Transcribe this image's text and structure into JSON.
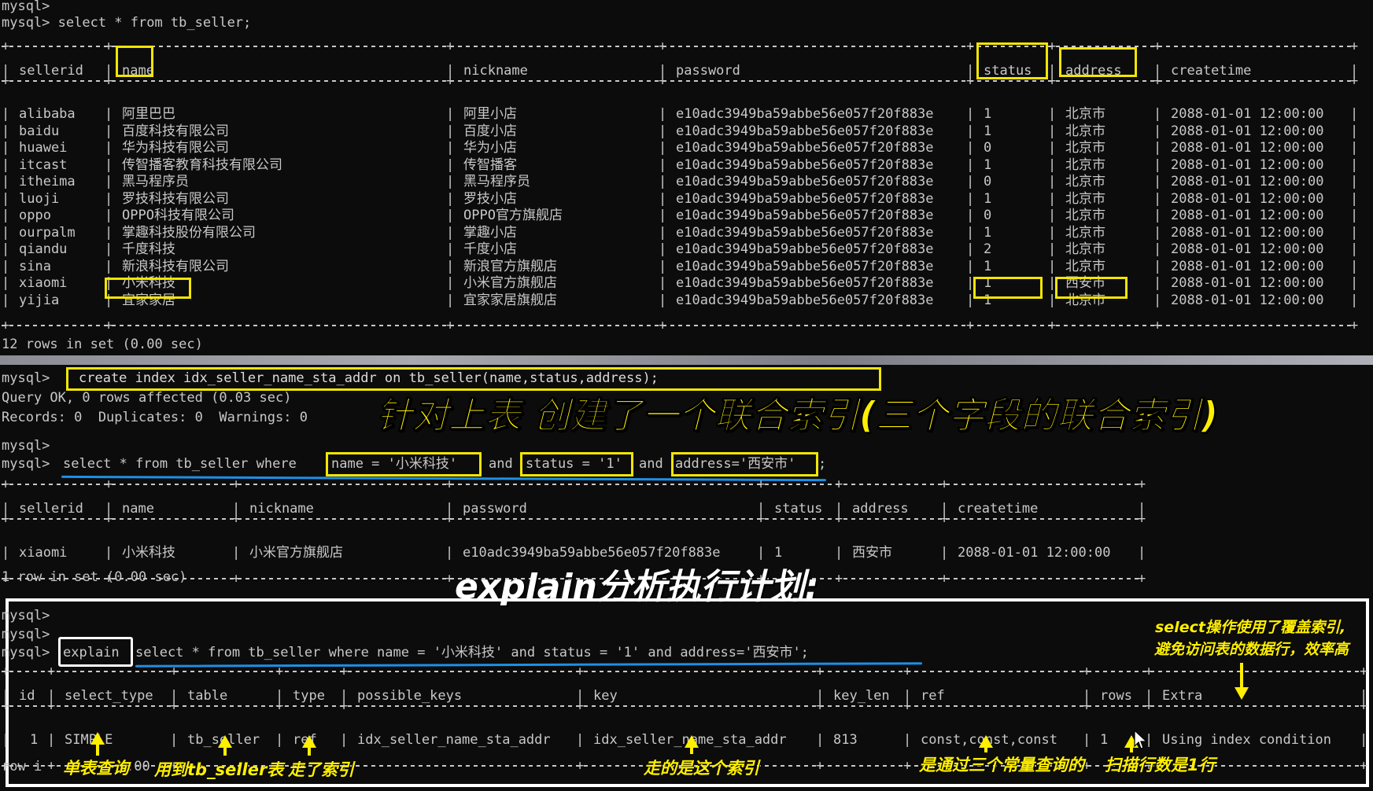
{
  "terminal": {
    "prompt_empty": "mysql>",
    "query1": "mysql> select * from tb_seller;",
    "sep1": "+----------+--------------------------------------+--------------------------+-----------------------------------+--------+----------+---------------------+",
    "header1": [
      "sellerid",
      "name",
      "nickname",
      "password",
      "status",
      "address",
      "createtime"
    ],
    "rows1": [
      [
        "alibaba",
        "阿里巴巴",
        "阿里小店",
        "e10adc3949ba59abbe56e057f20f883e",
        "1",
        "北京市",
        "2088-01-01 12:00:00"
      ],
      [
        "baidu",
        "百度科技有限公司",
        "百度小店",
        "e10adc3949ba59abbe56e057f20f883e",
        "1",
        "北京市",
        "2088-01-01 12:00:00"
      ],
      [
        "huawei",
        "华为科技有限公司",
        "华为小店",
        "e10adc3949ba59abbe56e057f20f883e",
        "0",
        "北京市",
        "2088-01-01 12:00:00"
      ],
      [
        "itcast",
        "传智播客教育科技有限公司",
        "传智播客",
        "e10adc3949ba59abbe56e057f20f883e",
        "1",
        "北京市",
        "2088-01-01 12:00:00"
      ],
      [
        "itheima",
        "黑马程序员",
        "黑马程序员",
        "e10adc3949ba59abbe56e057f20f883e",
        "0",
        "北京市",
        "2088-01-01 12:00:00"
      ],
      [
        "luoji",
        "罗技科技有限公司",
        "罗技小店",
        "e10adc3949ba59abbe56e057f20f883e",
        "1",
        "北京市",
        "2088-01-01 12:00:00"
      ],
      [
        "oppo",
        "OPPO科技有限公司",
        "OPPO官方旗舰店",
        "e10adc3949ba59abbe56e057f20f883e",
        "0",
        "北京市",
        "2088-01-01 12:00:00"
      ],
      [
        "ourpalm",
        "掌趣科技股份有限公司",
        "掌趣小店",
        "e10adc3949ba59abbe56e057f20f883e",
        "1",
        "北京市",
        "2088-01-01 12:00:00"
      ],
      [
        "qiandu",
        "千度科技",
        "千度小店",
        "e10adc3949ba59abbe56e057f20f883e",
        "2",
        "北京市",
        "2088-01-01 12:00:00"
      ],
      [
        "sina",
        "新浪科技有限公司",
        "新浪官方旗舰店",
        "e10adc3949ba59abbe56e057f20f883e",
        "1",
        "北京市",
        "2088-01-01 12:00:00"
      ],
      [
        "xiaomi",
        "小米科技",
        "小米官方旗舰店",
        "e10adc3949ba59abbe56e057f20f883e",
        "1",
        "西安市",
        "2088-01-01 12:00:00"
      ],
      [
        "yijia",
        "宜家家居",
        "宜家家居旗舰店",
        "e10adc3949ba59abbe56e057f20f883e",
        "1",
        "北京市",
        "2088-01-01 12:00:00"
      ]
    ],
    "rows_in_set1": "12 rows in set (0.00 sec)",
    "create_prompt": "mysql>",
    "create_cmd": "create index idx_seller_name_sta_addr on tb_seller(name,status,address);",
    "query_ok": "Query OK, 0 rows affected (0.03 sec)",
    "records": "Records: 0  Duplicates: 0  Warnings: 0",
    "query2_prefix": "mysql>",
    "query2_a": "select * from tb_seller where",
    "query2_name": "name = '小米科技'",
    "query2_and1": "and",
    "query2_status": "status = '1'",
    "query2_and2": "and",
    "query2_addr": "address='西安市'",
    "query2_end": ";",
    "header2": [
      "sellerid",
      "name",
      "nickname",
      "password",
      "status",
      "address",
      "createtime"
    ],
    "row2": [
      "xiaomi",
      "小米科技",
      "小米官方旗舰店",
      "e10adc3949ba59abbe56e057f20f883e",
      "1",
      "西安市",
      "2088-01-01 12:00:00"
    ],
    "rows_in_set2": "1 row in set (0.00 sec)",
    "explain_prompt1": "mysql>",
    "explain_prompt2": "mysql>",
    "explain_prompt3": "mysql>",
    "explain_kw": "explain",
    "explain_rest": "select * from tb_seller where name = '小米科技' and status = '1' and address='西安市';",
    "header3": [
      "id",
      "select_type",
      "table",
      "type",
      "possible_keys",
      "key",
      "key_len",
      "ref",
      "rows",
      "Extra"
    ],
    "row3": [
      "1",
      "SIMPLE",
      "tb_seller",
      "ref",
      "idx_seller_name_sta_addr",
      "idx_seller_name_sta_addr",
      "813",
      "const,const,const",
      "1",
      "Using index condition"
    ],
    "rows_in_set3_partial": "row i",
    "rows_in_set3_tail": ".00"
  },
  "annotations": {
    "title_index": "针对上表 创建了一个联合索引(三个字段的联合索引)",
    "title_explain": "explain分析执行计划:",
    "note_cover_1": "select操作使用了覆盖索引,",
    "note_cover_2": "避免访问表的数据行，效率高",
    "label_simple": "单表查询",
    "label_table": "用到tb_seller表",
    "label_type": "走了索引",
    "label_key": "走的是这个索引",
    "label_ref": "是通过三个常量查询的",
    "label_rows": "扫描行数是1行"
  },
  "colors": {
    "highlight": "#f2e600",
    "underline": "#1e8fe6",
    "terminal_text": "#c8c8c8",
    "background": "#0c0c0c"
  }
}
